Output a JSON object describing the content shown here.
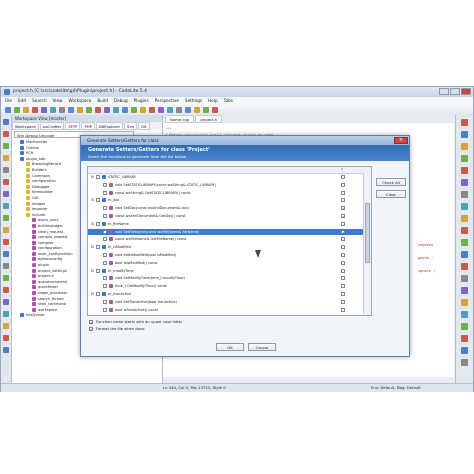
{
  "window": {
    "title": "project.h [C:\\src\\codelite\\git\\Plugin\\project.h] - CodeLite 5.4",
    "menu": [
      "File",
      "Edit",
      "Search",
      "View",
      "Workspace",
      "Build",
      "Debug",
      "Plugins",
      "Perspective",
      "Settings",
      "Help",
      "Tabs"
    ]
  },
  "workspace": {
    "pane_title": "Workspace View [master]",
    "tabs": [
      "Workspace",
      "wxCrafter",
      "SFTP",
      "PHP",
      "DbExplorer",
      "Svn",
      "Git"
    ],
    "config": "Win Debug Unicode",
    "tree": [
      {
        "label": "MacBundler",
        "indent": 1,
        "color": "#3b74c8"
      },
      {
        "label": "Outline",
        "indent": 1,
        "color": "#3b74c8"
      },
      {
        "label": "PCH",
        "indent": 1,
        "color": "#3b74c8"
      },
      {
        "label": "plugin_sdk",
        "indent": 1,
        "color": "#3b74c8"
      },
      {
        "label": "BrowsingRecord",
        "indent": 2,
        "color": "#e0b23a"
      },
      {
        "label": "Builders",
        "indent": 2,
        "color": "#e0b23a"
      },
      {
        "label": "Commons",
        "indent": 2,
        "color": "#e0b23a"
      },
      {
        "label": "configuration",
        "indent": 2,
        "color": "#e0b23a"
      },
      {
        "label": "Debugger",
        "indent": 2,
        "color": "#e0b23a"
      },
      {
        "label": "formbuilder",
        "indent": 2,
        "color": "#e0b23a"
      },
      {
        "label": "GUI",
        "indent": 2,
        "color": "#e0b23a"
      },
      {
        "label": "images",
        "indent": 2,
        "color": "#e0b23a"
      },
      {
        "label": "importer",
        "indent": 2,
        "color": "#e0b23a"
      },
      {
        "label": "include",
        "indent": 2,
        "color": "#e0b23a"
      },
      {
        "label": "async_exec",
        "indent": 3,
        "color": "#b54fb0"
      },
      {
        "label": "buildmanager",
        "indent": 3,
        "color": "#b54fb0"
      },
      {
        "label": "clean_request",
        "indent": 3,
        "color": "#b54fb0"
      },
      {
        "label": "compile_request",
        "indent": 3,
        "color": "#b54fb0"
      },
      {
        "label": "compiler",
        "indent": 3,
        "color": "#b54fb0"
      },
      {
        "label": "configuration",
        "indent": 3,
        "color": "#b54fb0"
      },
      {
        "label": "lexer_configuration",
        "indent": 3,
        "color": "#b54fb0"
      },
      {
        "label": "optionsconfig",
        "indent": 3,
        "color": "#b54fb0"
      },
      {
        "label": "plugin",
        "indent": 3,
        "color": "#b54fb0"
      },
      {
        "label": "project_settings",
        "indent": 3,
        "color": "#b54fb0"
      },
      {
        "label": "project.h",
        "indent": 3,
        "color": "#b54fb0"
      },
      {
        "label": "queuecommand",
        "indent": 3,
        "color": "#b54fb0"
      },
      {
        "label": "quickfinder",
        "indent": 3,
        "color": "#b54fb0"
      },
      {
        "label": "regex_processor",
        "indent": 3,
        "color": "#b54fb0"
      },
      {
        "label": "search_thread",
        "indent": 3,
        "color": "#b54fb0"
      },
      {
        "label": "shell_command",
        "indent": 3,
        "color": "#b54fb0"
      },
      {
        "label": "workspace",
        "indent": 3,
        "color": "#b54fb0"
      },
      {
        "label": "IvfsQueue",
        "indent": 1,
        "color": "#3b74c8"
      }
    ]
  },
  "editor": {
    "tab": "Name.cpp",
    "tab2": "project.h",
    "lines": [
      {
        "text": "/**",
        "color": "#5a8a3a"
      },
      {
        "text": " * Return the project build settings object by name",
        "color": "#5a8a3a"
      },
      {
        "text": " */",
        "color": "#5a8a3a"
      },
      {
        "text": "BuildConfigPtr GetBuildConfiguration(const wxString &name) const;",
        "color": "#223b7a"
      },
      {
        "text": "",
        "color": "#222"
      },
      {
        "text": "ProjectSettingsPtr GetSettings() const;",
        "color": "#223b7a"
      }
    ],
    "side_snippets": [
      {
        "text": "regexes",
        "color": "#b02a2a"
      },
      {
        "text": "gnore ;",
        "color": "#b02a2a"
      },
      {
        "text": "ignore ;",
        "color": "#b02a2a"
      }
    ]
  },
  "status": {
    "position": "Ln 444,  Col 0,  Pos 13722,  Style 0",
    "env": "Env: Default, Dbg: Default"
  },
  "dialog": {
    "title": "Generate Setters/Getters for class",
    "heading": "Generate Setters/Getters for class 'Project'",
    "subheading": "Select the functions to generate from the list below",
    "col_check": "?",
    "check_all": "Check All",
    "clear": "Clear",
    "rows": [
      {
        "label": "STATIC_LIBRARY",
        "indent": 1,
        "type": "member",
        "checked": false,
        "selected": false
      },
      {
        "label": "void SetSTATICLIBRARY(const wxString& STATIC_LIBRARY)",
        "indent": 2,
        "type": "func",
        "checked": false,
        "selected": false
      },
      {
        "label": "const wxString& GetSTATICLIBRARY() const",
        "indent": 2,
        "type": "func",
        "checked": false,
        "selected": false
      },
      {
        "label": "m_doc",
        "indent": 1,
        "type": "member",
        "checked": false,
        "selected": false
      },
      {
        "label": "void SetDoc(const wxXmlDocument& doc)",
        "indent": 2,
        "type": "func",
        "checked": true,
        "selected": false
      },
      {
        "label": "const wxXmlDocument& GetDoc() const",
        "indent": 2,
        "type": "func",
        "checked": true,
        "selected": false
      },
      {
        "label": "m_fileName",
        "indent": 1,
        "type": "member",
        "checked": false,
        "selected": false
      },
      {
        "label": "void SetFileName(const wxFileName& fileName)",
        "indent": 2,
        "type": "func",
        "checked": true,
        "selected": true
      },
      {
        "label": "const wxFileName& GetFileName() const",
        "indent": 2,
        "type": "func",
        "checked": false,
        "selected": false
      },
      {
        "label": "m_isModified",
        "indent": 1,
        "type": "member",
        "checked": false,
        "selected": false
      },
      {
        "label": "void SetIsModified(bool isModified)",
        "indent": 2,
        "type": "func",
        "checked": false,
        "selected": false
      },
      {
        "label": "bool IsIsModified() const",
        "indent": 2,
        "type": "func",
        "checked": false,
        "selected": false
      },
      {
        "label": "m_modifyTime",
        "indent": 1,
        "type": "member",
        "checked": false,
        "selected": false
      },
      {
        "label": "void SetModifyTime(time_t modifyTime)",
        "indent": 2,
        "type": "func",
        "checked": false,
        "selected": false
      },
      {
        "label": "time_t GetModifyTime() const",
        "indent": 2,
        "type": "func",
        "checked": false,
        "selected": false
      },
      {
        "label": "m_tranActive",
        "indent": 1,
        "type": "member",
        "checked": false,
        "selected": false
      },
      {
        "label": "void SetTranActive(bool tranActive)",
        "indent": 2,
        "type": "func",
        "checked": false,
        "selected": false
      },
      {
        "label": "bool IsTranActive() const",
        "indent": 2,
        "type": "func",
        "checked": false,
        "selected": false
      }
    ],
    "opt_uppercase": "Function name starts with an upper case letter",
    "opt_format": "Format the file when done",
    "opt_uppercase_checked": true,
    "opt_format_checked": true,
    "ok": "OK",
    "cancel": "Cancel"
  }
}
